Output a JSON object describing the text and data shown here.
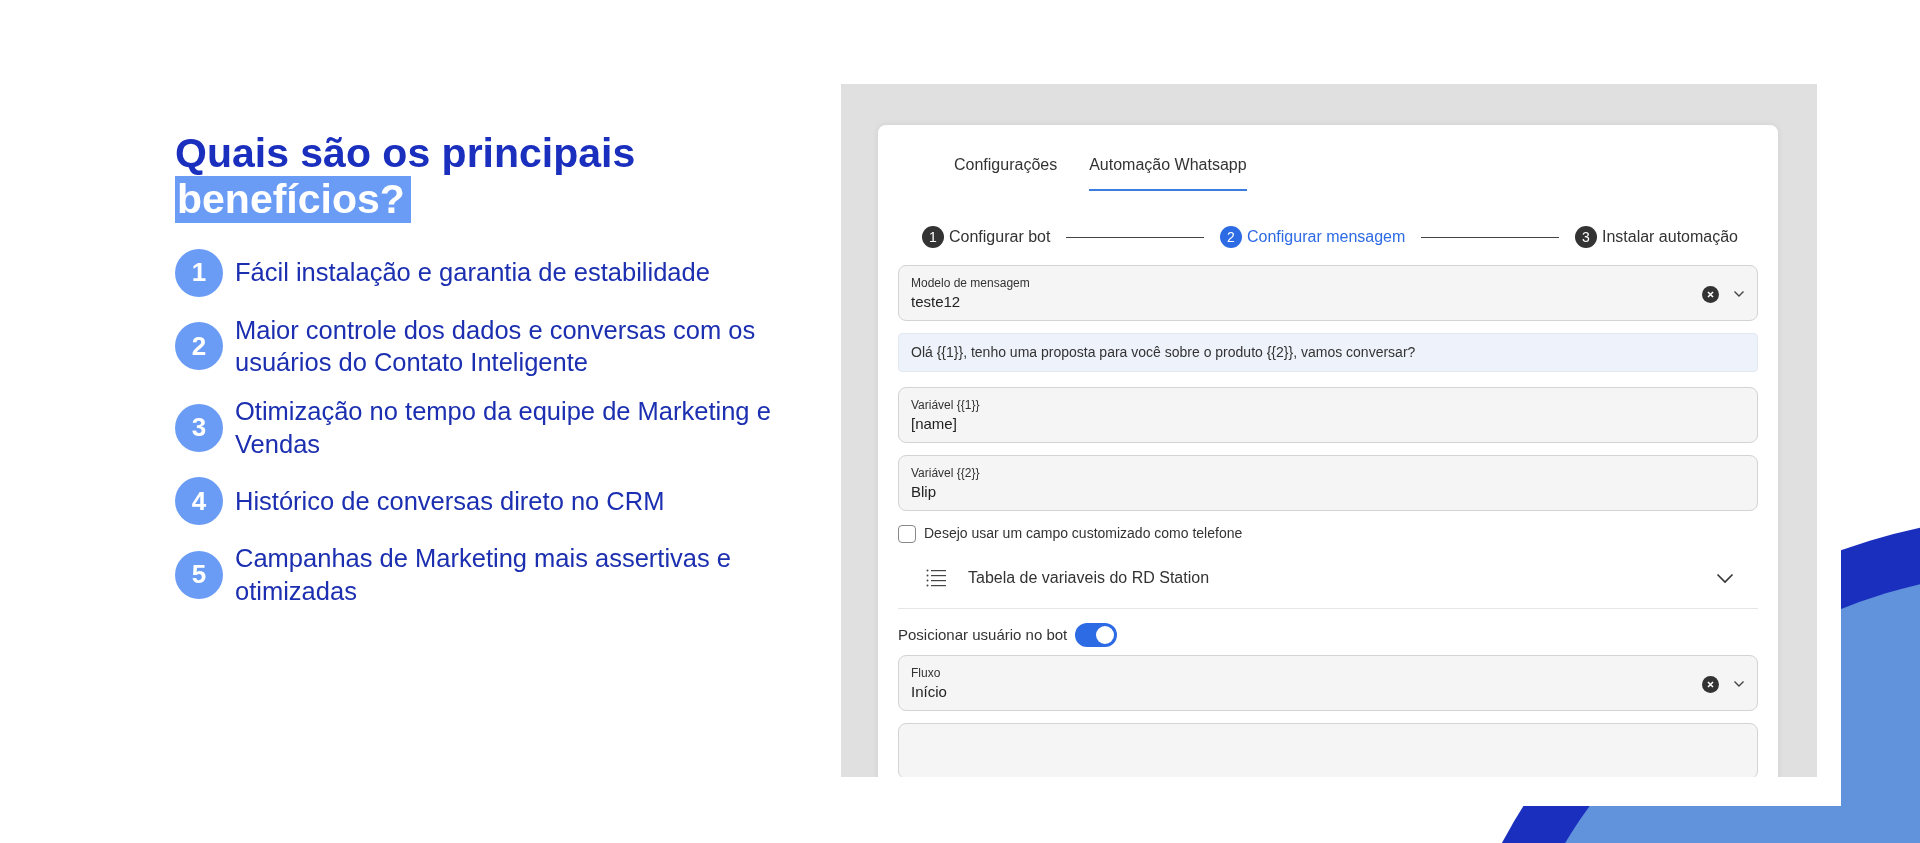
{
  "heading": {
    "line1": "Quais são os principais",
    "highlight": "benefícios?"
  },
  "benefits": [
    {
      "number": "1",
      "text": "Fácil instalação e garantia de estabilidade"
    },
    {
      "number": "2",
      "text": "Maior controle dos dados e conversas com os usuários do Contato Inteligente"
    },
    {
      "number": "3",
      "text": "Otimização no tempo da equipe de Marketing e Vendas"
    },
    {
      "number": "4",
      "text": "Histórico de conversas direto no CRM"
    },
    {
      "number": "5",
      "text": "Campanhas de Marketing mais assertivas e otimizadas"
    }
  ],
  "app": {
    "tabs": [
      {
        "label": "Configurações",
        "selected": false
      },
      {
        "label": "Automação Whatsapp",
        "selected": true
      }
    ],
    "steps": [
      {
        "number": "1",
        "label": "Configurar bot",
        "selected": false
      },
      {
        "number": "2",
        "label": "Configurar mensagem",
        "selected": true
      },
      {
        "number": "3",
        "label": "Instalar automação",
        "selected": false
      }
    ],
    "form": [
      {
        "kind": "select",
        "label": "Modelo de mensagem",
        "value": "teste12"
      },
      {
        "kind": "message",
        "text": "Olá {{1}}, tenho uma proposta para você sobre o produto {{2}}, vamos conversar?"
      },
      {
        "kind": "input",
        "label": "Variável {{1}}",
        "value": "[name]"
      },
      {
        "kind": "input",
        "label": "Variável {{2}}",
        "value": "Blip"
      },
      {
        "kind": "checkbox",
        "label": "Desejo usar um campo customizado como telefone",
        "checked": false
      },
      {
        "kind": "accordion",
        "label": "Tabela de variaveis do RD Station",
        "expanded": false
      },
      {
        "kind": "toggle",
        "label": "Posicionar usuário no bot",
        "on": true
      },
      {
        "kind": "select",
        "label": "Fluxo",
        "value": "Início"
      },
      {
        "kind": "input"
      }
    ]
  }
}
